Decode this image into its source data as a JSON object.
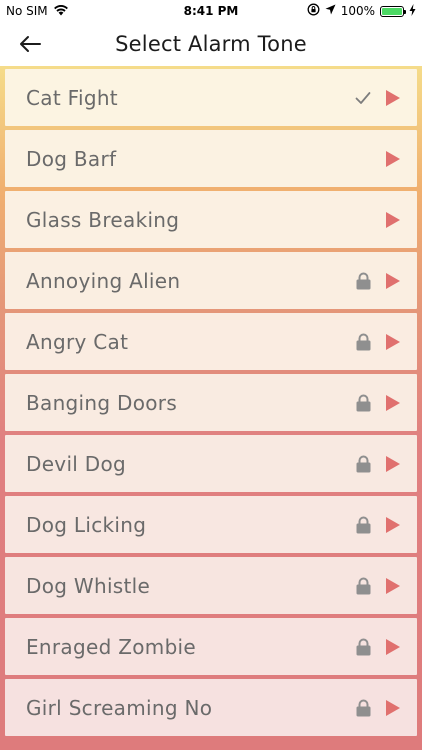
{
  "status_bar": {
    "carrier": "No SIM",
    "time": "8:41 PM",
    "battery_percent": "100%",
    "battery_level": 1.0
  },
  "nav": {
    "title": "Select Alarm Tone"
  },
  "colors": {
    "play": "#e0706e",
    "lock": "#8f8f8f",
    "check": "#7d7d7d"
  },
  "tones": [
    {
      "label": "Cat Fight",
      "selected": true,
      "locked": false
    },
    {
      "label": "Dog Barf",
      "selected": false,
      "locked": false
    },
    {
      "label": "Glass Breaking",
      "selected": false,
      "locked": false
    },
    {
      "label": "Annoying Alien",
      "selected": false,
      "locked": true
    },
    {
      "label": "Angry Cat",
      "selected": false,
      "locked": true
    },
    {
      "label": "Banging Doors",
      "selected": false,
      "locked": true
    },
    {
      "label": "Devil Dog",
      "selected": false,
      "locked": true
    },
    {
      "label": "Dog Licking",
      "selected": false,
      "locked": true
    },
    {
      "label": "Dog Whistle",
      "selected": false,
      "locked": true
    },
    {
      "label": "Enraged Zombie",
      "selected": false,
      "locked": true
    },
    {
      "label": "Girl Screaming No",
      "selected": false,
      "locked": true
    }
  ]
}
